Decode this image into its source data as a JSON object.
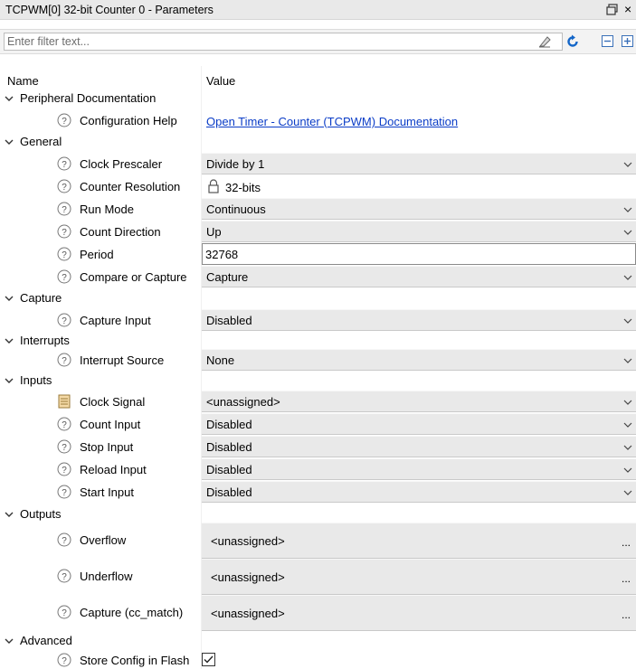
{
  "window": {
    "title": "TCPWM[0] 32-bit Counter 0 - Parameters",
    "float_glyph": "⧉",
    "close_glyph": "×"
  },
  "filter": {
    "placeholder": "Enter filter text...",
    "value": "",
    "icons": [
      "eraser-icon",
      "refresh-icon",
      "collapse-all-icon",
      "expand-all-icon"
    ]
  },
  "table": {
    "header_name": "Name",
    "header_value": "Value"
  },
  "sections": {
    "peripheral_doc": {
      "label": "Peripheral Documentation",
      "config_help": {
        "name": "Configuration Help",
        "value": "Open Timer - Counter (TCPWM) Documentation"
      }
    },
    "general": {
      "label": "General",
      "clock_prescaler": {
        "name": "Clock Prescaler",
        "value": "Divide by 1"
      },
      "counter_resolution": {
        "name": "Counter Resolution",
        "value": "32-bits"
      },
      "run_mode": {
        "name": "Run Mode",
        "value": "Continuous"
      },
      "count_direction": {
        "name": "Count Direction",
        "value": "Up"
      },
      "period": {
        "name": "Period",
        "value": "32768"
      },
      "compare_capture": {
        "name": "Compare or Capture",
        "value": "Capture"
      }
    },
    "capture": {
      "label": "Capture",
      "capture_input": {
        "name": "Capture Input",
        "value": "Disabled"
      }
    },
    "interrupts": {
      "label": "Interrupts",
      "interrupt_source": {
        "name": "Interrupt Source",
        "value": "None"
      }
    },
    "inputs": {
      "label": "Inputs",
      "clock_signal": {
        "name": "Clock Signal",
        "value": "<unassigned>"
      },
      "count_input": {
        "name": "Count Input",
        "value": "Disabled"
      },
      "stop_input": {
        "name": "Stop Input",
        "value": "Disabled"
      },
      "reload_input": {
        "name": "Reload Input",
        "value": "Disabled"
      },
      "start_input": {
        "name": "Start Input",
        "value": "Disabled"
      }
    },
    "outputs": {
      "label": "Outputs",
      "overflow": {
        "name": "Overflow",
        "value": "<unassigned>"
      },
      "underflow": {
        "name": "Underflow",
        "value": "<unassigned>"
      },
      "capture_cc": {
        "name": "Capture (cc_match)",
        "value": "<unassigned>"
      },
      "ellipsis": "..."
    },
    "advanced": {
      "label": "Advanced",
      "store_config": {
        "name": "Store Config in Flash",
        "checked": true
      }
    }
  }
}
